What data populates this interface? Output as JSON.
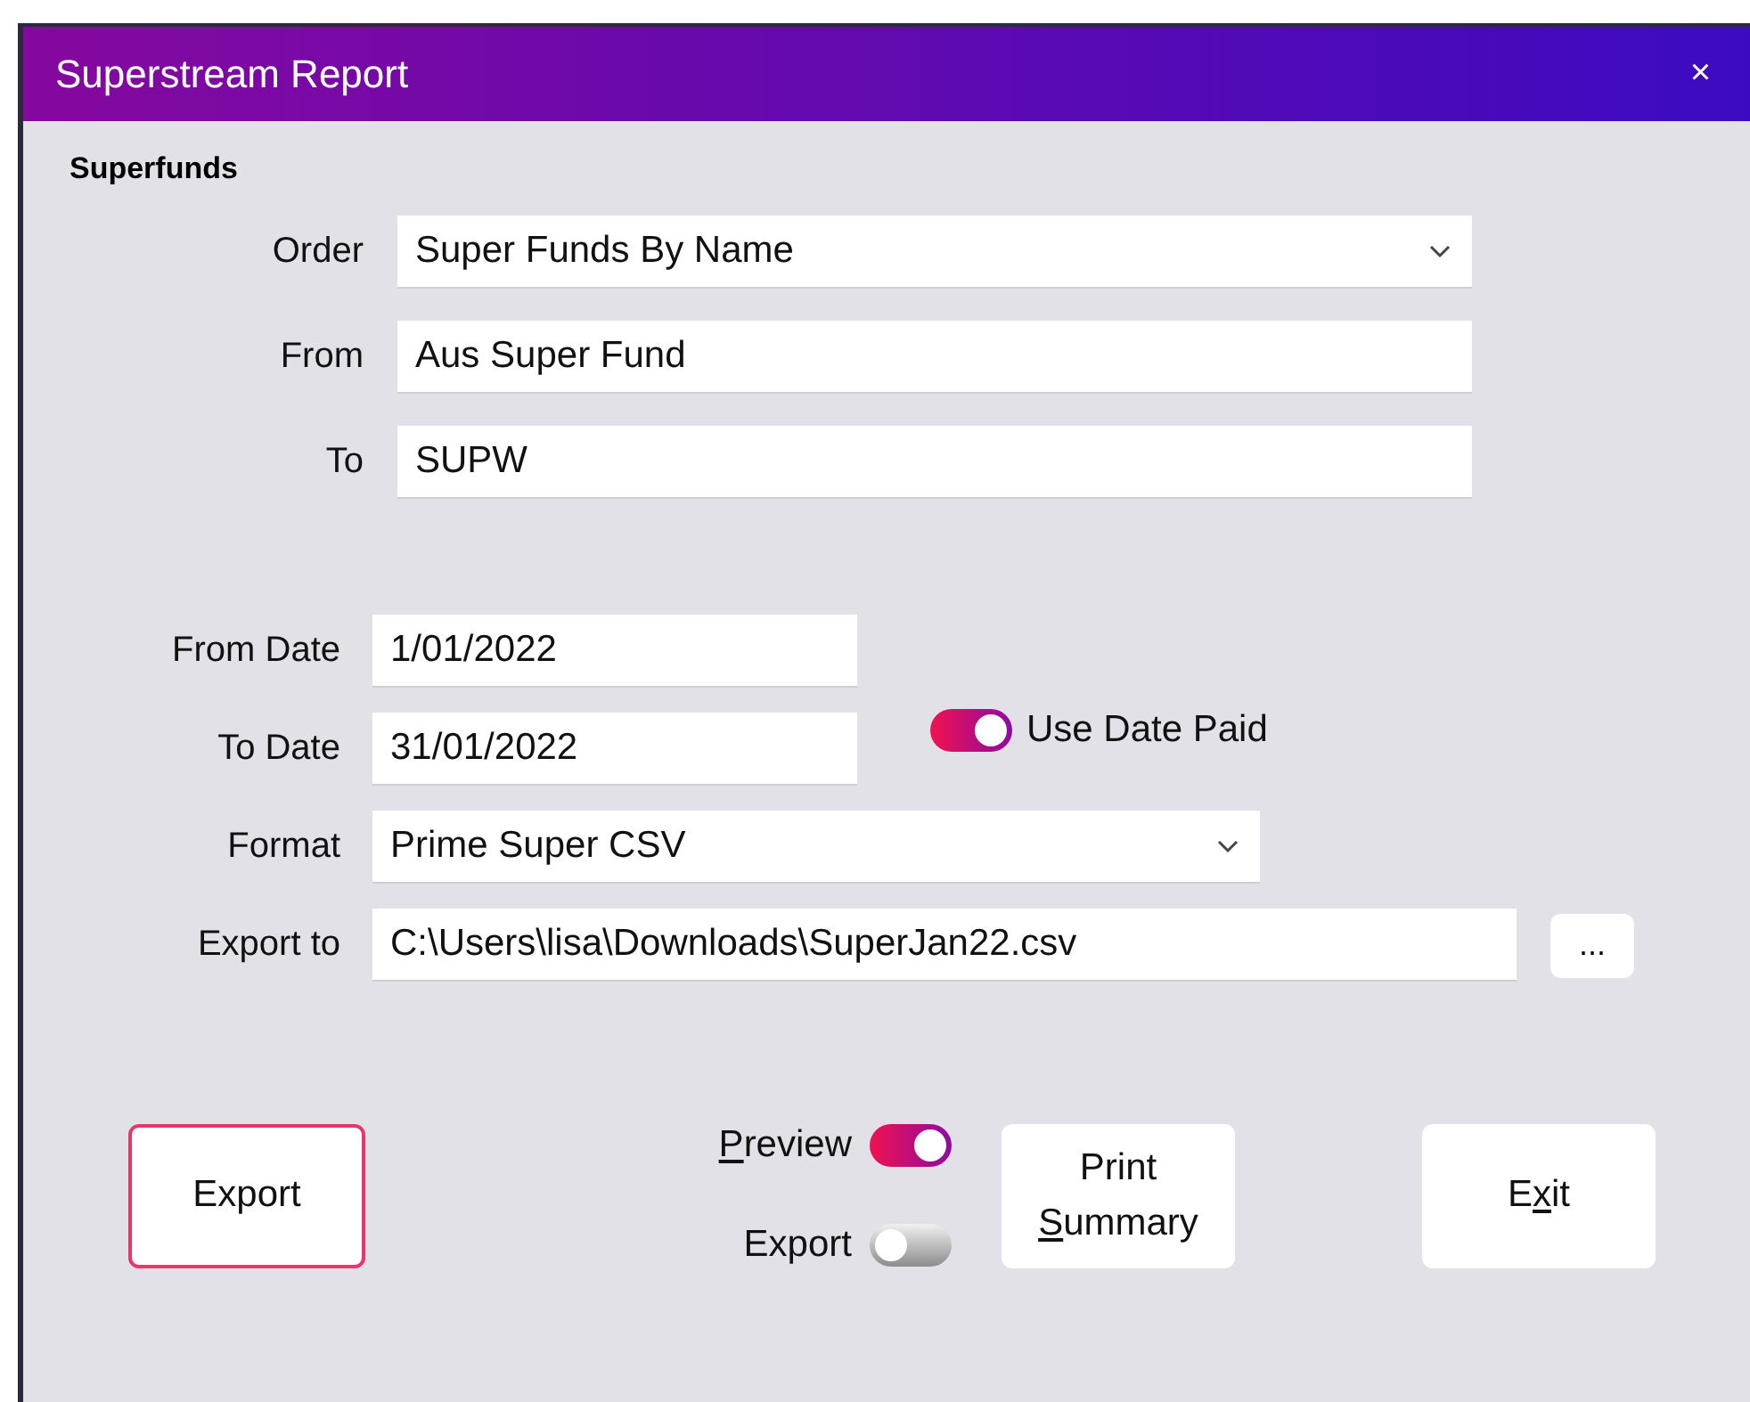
{
  "window": {
    "title": "Superstream Report",
    "close": "×"
  },
  "section": {
    "title": "Superfunds"
  },
  "fund_fields": [
    {
      "label": "Order",
      "kind": "select",
      "value": "Super Funds By Name"
    },
    {
      "label": "From",
      "kind": "text",
      "value": "Aus Super Fund"
    },
    {
      "label": "To",
      "kind": "text",
      "value": "SUPW"
    }
  ],
  "date_fields": [
    {
      "label": "From Date",
      "kind": "date",
      "value": "1/01/2022"
    },
    {
      "label": "To Date",
      "kind": "date",
      "value": "31/01/2022",
      "toggle": {
        "label": "Use Date Paid",
        "on": true
      }
    },
    {
      "label": "Format",
      "kind": "select",
      "value": "Prime Super CSV"
    },
    {
      "label": "Export to",
      "kind": "path",
      "value": "C:\\Users\\lisa\\Downloads\\SuperJan22.csv",
      "browse": "..."
    }
  ],
  "options": [
    {
      "parts": [
        {
          "text": "P",
          "underline": true
        },
        {
          "text": "review",
          "underline": false
        }
      ],
      "on": true
    },
    {
      "parts": [
        {
          "text": "Export",
          "underline": false
        }
      ],
      "on": false
    }
  ],
  "buttons": [
    {
      "lines": [
        [
          {
            "text": "Export",
            "underline": false
          }
        ]
      ],
      "focused": true
    },
    {
      "lines": [
        [
          {
            "text": "Print",
            "underline": false
          }
        ],
        [
          {
            "text": "S",
            "underline": true
          },
          {
            "text": "ummary",
            "underline": false
          }
        ]
      ],
      "focused": false
    },
    {
      "lines": [
        [
          {
            "text": "E",
            "underline": false
          },
          {
            "text": "x",
            "underline": true
          },
          {
            "text": "it",
            "underline": false
          }
        ]
      ],
      "focused": false
    }
  ]
}
